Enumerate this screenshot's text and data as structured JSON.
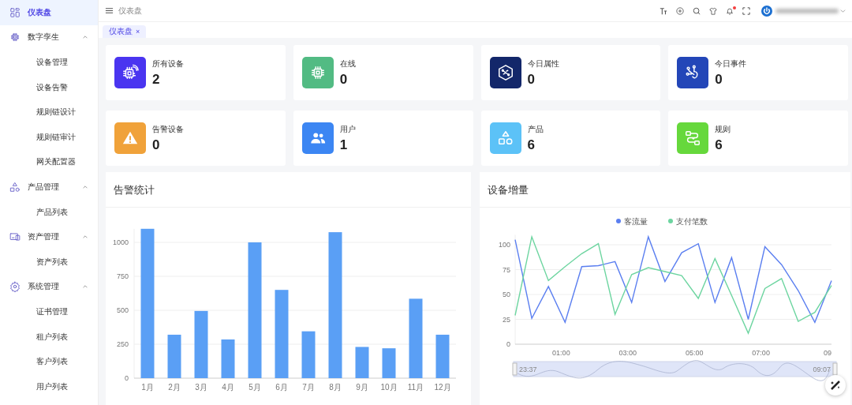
{
  "sidebar": {
    "items": [
      {
        "kind": "link",
        "label": "仪表盘",
        "selected": true
      },
      {
        "kind": "group",
        "label": "数字孪生",
        "selected": false,
        "expanded": true,
        "children": [
          {
            "label": "设备管理",
            "selected": false
          },
          {
            "label": "设备告警",
            "selected": false
          },
          {
            "label": "规则链设计",
            "selected": false
          },
          {
            "label": "规则链审计",
            "selected": false
          },
          {
            "label": "网关配置器",
            "selected": false
          }
        ]
      },
      {
        "kind": "group",
        "label": "产品管理",
        "selected": false,
        "expanded": true,
        "children": [
          {
            "label": "产品列表",
            "selected": false
          }
        ]
      },
      {
        "kind": "group",
        "label": "资产管理",
        "selected": false,
        "expanded": true,
        "children": [
          {
            "label": "资产列表",
            "selected": false
          }
        ]
      },
      {
        "kind": "group",
        "label": "系统管理",
        "selected": false,
        "expanded": true,
        "children": [
          {
            "label": "证书管理",
            "selected": false
          },
          {
            "label": "租户列表",
            "selected": false
          },
          {
            "label": "客户列表",
            "selected": false
          },
          {
            "label": "用户列表",
            "selected": false
          }
        ]
      }
    ]
  },
  "header": {
    "breadcrumb": "仪表盘",
    "notification_unread": true
  },
  "tabs": [
    {
      "label": "仪表盘",
      "selected": true,
      "closable": true,
      "close": "×"
    }
  ],
  "stats": [
    {
      "label": "所有设备",
      "value": "2",
      "color": "#4a35f0"
    },
    {
      "label": "在线",
      "value": "0",
      "color": "#52bb83"
    },
    {
      "label": "今日属性",
      "value": "0",
      "color": "#13276a"
    },
    {
      "label": "今日事件",
      "value": "0",
      "color": "#2346b8"
    },
    {
      "label": "告警设备",
      "value": "0",
      "color": "#f0a23a"
    },
    {
      "label": "用户",
      "value": "1",
      "color": "#3c86f3"
    },
    {
      "label": "产品",
      "value": "6",
      "color": "#5cc2f7"
    },
    {
      "label": "规则",
      "value": "6",
      "color": "#66d83c"
    }
  ],
  "alarm_panel": {
    "title": "告警统计",
    "chart_data": {
      "type": "bar",
      "categories": [
        "1月",
        "2月",
        "3月",
        "4月",
        "5月",
        "6月",
        "7月",
        "8月",
        "9月",
        "10月",
        "11月",
        "12月"
      ],
      "values": [
        1100,
        320,
        495,
        285,
        1000,
        650,
        345,
        1075,
        230,
        220,
        585,
        320
      ],
      "color": "#5a9ff5",
      "ylim": [
        0,
        1100
      ],
      "yticks": [
        0,
        250,
        500,
        750,
        1000
      ],
      "grid": true
    }
  },
  "growth_panel": {
    "title": "设备增量",
    "chart_data": {
      "type": "line",
      "x": [
        -0.383,
        0.117,
        0.617,
        1.117,
        1.617,
        2.117,
        2.617,
        3.117,
        3.617,
        4.117,
        4.617,
        5.117,
        5.617,
        6.117,
        6.617,
        7.117,
        7.617,
        8.117,
        8.617,
        9.117
      ],
      "series": [
        {
          "name": "客流量",
          "color": "#5b7ff0",
          "values": [
            105,
            26,
            58,
            22,
            78,
            79,
            83,
            42,
            108,
            63,
            92,
            101,
            42,
            87,
            25,
            98,
            80,
            54,
            22,
            64
          ]
        },
        {
          "name": "支付笔数",
          "color": "#6dd5a0",
          "values": [
            29,
            108,
            64,
            78,
            91,
            101,
            30,
            70,
            77,
            73,
            69,
            46,
            86,
            49,
            11,
            56,
            66,
            23,
            32,
            59
          ]
        }
      ],
      "xlim": [
        -0.383,
        9.117
      ],
      "ylim": [
        0,
        110
      ],
      "yticks": [
        0,
        25,
        50,
        75,
        100
      ],
      "grid": true,
      "legend": true,
      "xticks": [
        {
          "value": 1,
          "label": "01:00"
        },
        {
          "value": 3,
          "label": "03:00"
        },
        {
          "value": 5,
          "label": "05:00"
        },
        {
          "value": 7,
          "label": "07:00"
        },
        {
          "value": 9,
          "label": "09"
        }
      ]
    },
    "zoom_slider": {
      "start": "23:37",
      "end": "09:07"
    }
  }
}
